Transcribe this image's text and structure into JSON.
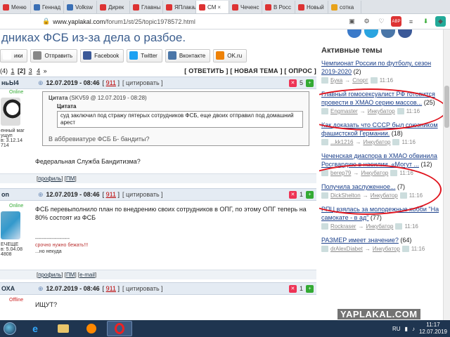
{
  "tabs": [
    {
      "label": "Меню",
      "color": "#d33",
      "active": false
    },
    {
      "label": "Геннад",
      "color": "#3a6fb5",
      "active": false
    },
    {
      "label": "Volksw",
      "color": "#3a6fb5",
      "active": false
    },
    {
      "label": "Дирек",
      "color": "#d33",
      "active": false
    },
    {
      "label": "Главны",
      "color": "#d33",
      "active": false
    },
    {
      "label": "ЯПлакал",
      "color": "#d33",
      "active": false
    },
    {
      "label": "СМ",
      "color": "#d33",
      "active": true
    },
    {
      "label": "Чеченс",
      "color": "#d33",
      "active": false
    },
    {
      "label": "В Росс",
      "color": "#d33",
      "active": false
    },
    {
      "label": "Новый",
      "color": "#d33",
      "active": false
    },
    {
      "label": "сотка",
      "color": "#e8a21a",
      "active": false
    }
  ],
  "address": {
    "domain": "www.yaplakal.com",
    "path": "/forum1/st/25/topic1978572.html"
  },
  "headline": "дниках ФСБ из-за дела о разбое.",
  "share_buttons": [
    {
      "label": "ики",
      "icon": "mail-icon",
      "color": "#ffffff"
    },
    {
      "label": "Отправить",
      "icon": "mail-icon",
      "color": "#888888"
    },
    {
      "label": "Facebook",
      "icon": "facebook-icon",
      "color": "#3b5998"
    },
    {
      "label": "Twitter",
      "icon": "twitter-icon",
      "color": "#1da1f2"
    },
    {
      "label": "Вконтакте",
      "icon": "vk-icon",
      "color": "#4a76a8"
    },
    {
      "label": "OK.ru",
      "icon": "ok-icon",
      "color": "#ee8208"
    }
  ],
  "pager": {
    "prefix": "(4)",
    "pages": [
      "1",
      "2",
      "3",
      "4"
    ],
    "current": "2",
    "suffix": "»"
  },
  "actions": "[ ОТВЕТИТЬ ] [ НОВАЯ ТЕМА ] [ ОПРОС ]",
  "posts": [
    {
      "user": "ньЫ4",
      "status": "Online",
      "user_info": [
        "енный маг",
        "ущуп",
        "в: 3.12.14",
        "714"
      ],
      "date": "12.07.2019 - 08:46",
      "num": "911",
      "cite": "цитировать",
      "votes": "5",
      "quote_title": "Цитата",
      "quote_author": "(SKV59 @ 12.07.2019 - 08:28)",
      "inner_label": "Цитата",
      "inner_text": "суд заключил под стражу пятерых сотрудников ФСБ, еще двоих отправил под домашний арест",
      "quote_after": "В аббревиатуре ФСБ Б- бандиты?",
      "body": "Федеральная Служба Бандитизма?",
      "footer": [
        "профиль",
        "ПМ"
      ]
    },
    {
      "user": "on",
      "status": "Online",
      "user_info": [
        "ЕЧЕЩЕ",
        "в: 5.04.08",
        "4808"
      ],
      "date": "12.07.2019 - 08:46",
      "num": "911",
      "cite": "цитировать",
      "votes": "1",
      "body": "ФСБ перевыполнило план по внедрению своих сотрудников в ОПГ, по этому ОПГ теперь на 80% состоят из ФСБ",
      "sig_line": "---------------------",
      "sig1": "срочно нужно бежать!!!",
      "sig2": "...но некуда",
      "footer": [
        "профиль",
        "ПМ",
        "e-mail"
      ]
    },
    {
      "user": "ОХА",
      "status": "Offline",
      "date": "12.07.2019 - 08:46",
      "num": "911",
      "cite": "цитировать",
      "votes": "1",
      "body": "ИЩУТ?"
    }
  ],
  "sidebar": {
    "title": "Активные темы",
    "topics": [
      {
        "title": "Чемпионат России по футболу, сезон 2019-2020",
        "count": "(2)",
        "user": "Бука",
        "cat": "Спорт",
        "time": "11:16"
      },
      {
        "title": "Главный гомосексуалист РФ готовится провести в ХМАО серию массов...",
        "count": "(25)",
        "user": "Engmaster",
        "cat": "Инкубатор",
        "time": "11:16"
      },
      {
        "title": "Как доказать что СССР был союзником фашистской Германии.",
        "count": "(18)",
        "user": "...kk1216",
        "cat": "Инкубатор",
        "time": "11:16"
      },
      {
        "title": "Чеченская диаспора в ХМАО обвинила Росгвардию в насилии. «Могут ...",
        "count": "(12)",
        "user": "berep79",
        "cat": "Инкубатор",
        "time": "11:16"
      },
      {
        "title": "Получила заслуженное...",
        "count": "(7)",
        "user": "DickShelton",
        "cat": "Инкубатор",
        "time": "11:16"
      },
      {
        "title": "РПЦ взялась за молодежные хобби \"На самокате - в ад\"",
        "count": "(77)",
        "user": "Rockraser",
        "cat": "Инкубатор",
        "time": "11:16"
      },
      {
        "title": "РАЗМЕР имеет значение?",
        "count": "(64)",
        "user": "drAlexDiabet",
        "cat": "Инкубатор",
        "time": "11:16"
      }
    ]
  },
  "watermark": "YAPLAKAL.COM",
  "tray": {
    "lang": "RU",
    "time": "11:17",
    "date": "12.07.2019"
  }
}
